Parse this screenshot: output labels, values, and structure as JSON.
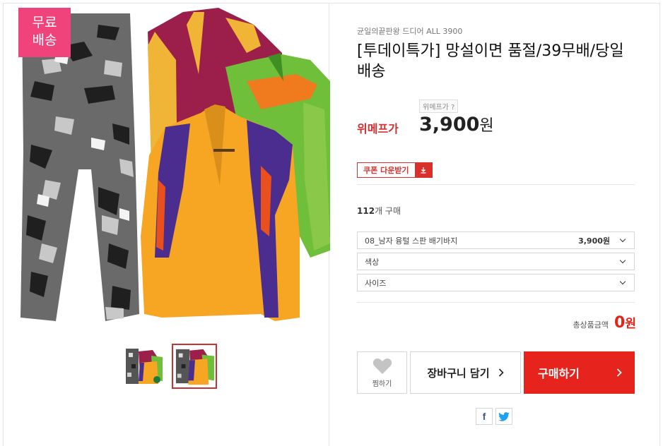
{
  "badge": {
    "line1": "무료",
    "line2": "배송"
  },
  "product": {
    "seller": "균일의끝판왕 드디어 ALL 3900",
    "title": "[투데이특가] 망설이면 품절/39무배/당일배송",
    "wemakeprice_tip": "위메프가 ?",
    "price_label": "위메프가",
    "price": "3,900",
    "price_unit": "원"
  },
  "coupon": {
    "label": "쿠폰 다운받기"
  },
  "purchase_count": {
    "count": "112",
    "suffix": "개 구매"
  },
  "options": {
    "selected": {
      "label": "08_남자 융털 스판 배기바지",
      "price": "3,900원"
    },
    "color": {
      "label": "색상"
    },
    "size": {
      "label": "사이즈"
    }
  },
  "total": {
    "label": "총상품금액",
    "value": "0",
    "unit": "원"
  },
  "actions": {
    "wish_label": "찜하기",
    "cart_label": "장바구니 담기",
    "buy_label": "구매하기"
  },
  "social": {
    "facebook": "f",
    "twitter": "twitter-icon"
  },
  "colors": {
    "accent": "#e6231c",
    "badge": "#f0437c"
  }
}
